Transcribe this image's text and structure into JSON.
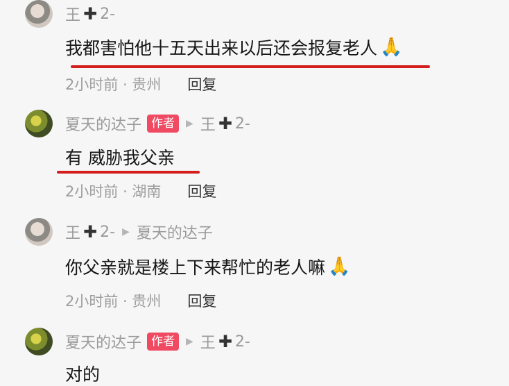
{
  "comments": [
    {
      "name": "王",
      "rank": "2-",
      "text": "我都害怕他十五天出来以后还会报复老人",
      "emoji": "🙏",
      "time": "2小时前 · 贵州",
      "reply": "回复"
    },
    {
      "name": "夏天的达子",
      "badge": "作者",
      "reply_to_name": "王",
      "reply_to_rank": "2-",
      "text": "有 威胁我父亲",
      "time": "2小时前 · 湖南",
      "reply": "回复"
    },
    {
      "name": "王",
      "rank": "2-",
      "reply_to_name": "夏天的达子",
      "text": "你父亲就是楼上下来帮忙的老人嘛",
      "emoji": "🙏",
      "time": "2小时前 · 贵州",
      "reply": "回复"
    },
    {
      "name": "夏天的达子",
      "badge": "作者",
      "reply_to_name": "王",
      "reply_to_rank": "2-",
      "text": "对的"
    }
  ],
  "colors": {
    "underline": "#d41e1e",
    "badge": "#f04a62"
  }
}
